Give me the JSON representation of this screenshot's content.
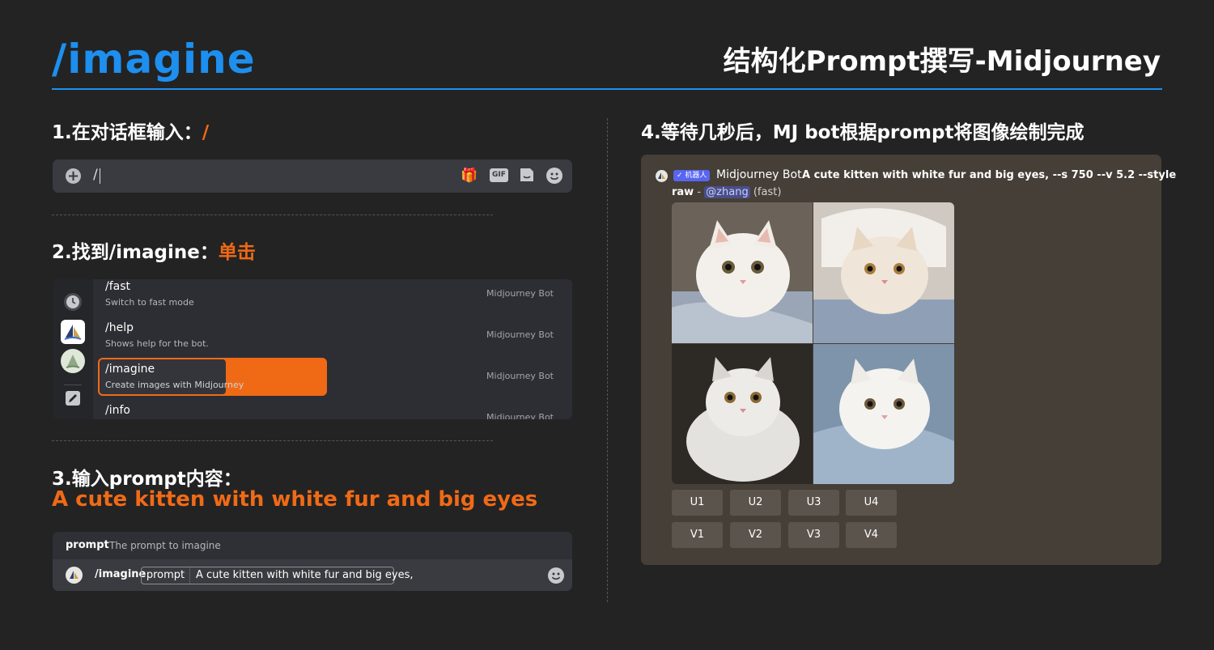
{
  "header": {
    "big_title": "/imagine",
    "slide_title": "结构化Prompt撰写-Midjourney"
  },
  "step1": {
    "heading": "1.在对话框输入：",
    "accent": "/",
    "input_value": "/"
  },
  "step2": {
    "heading": "2.找到/imagine：",
    "accent": "单击",
    "commands": [
      {
        "name": "/fast",
        "desc": "Switch to fast mode",
        "bot": "Midjourney Bot"
      },
      {
        "name": "/help",
        "desc": "Shows help for the bot.",
        "bot": "Midjourney Bot"
      },
      {
        "name": "/imagine",
        "desc": "Create images with Midjourney",
        "bot": "Midjourney Bot"
      },
      {
        "name": "/info",
        "desc": "",
        "bot": "Midjourney Bot"
      }
    ]
  },
  "step3": {
    "heading": "3.输入prompt内容：",
    "accent": "A cute kitten with white fur and big eyes",
    "param_label": "prompt",
    "param_hint": "The prompt to imagine",
    "command": "/imagine",
    "pill_label": "prompt",
    "pill_value": "A cute kitten with white fur and big eyes,"
  },
  "step4": {
    "heading": "4.等待几秒后，MJ bot根据prompt将图像绘制完成",
    "badge": "✓ 机器人",
    "bot_name": "Midjourney Bot",
    "prompt_text": "A cute kitten with white fur and big eyes, --s 750 --v 5.2 --style",
    "line2_raw": "raw",
    "line2_sep": " - ",
    "mention": "@zhang",
    "speed": " (fast)",
    "upscale_buttons": [
      "U1",
      "U2",
      "U3",
      "U4"
    ],
    "variation_buttons": [
      "V1",
      "V2",
      "V3",
      "V4"
    ]
  },
  "colors": {
    "accent_blue": "#1d8fef",
    "accent_orange": "#f06a16",
    "background": "#232323"
  },
  "icons": [
    "add-circle-icon",
    "gift-icon",
    "gif-icon",
    "sticker-icon",
    "emoji-icon",
    "clock-icon",
    "pencil-icon"
  ]
}
